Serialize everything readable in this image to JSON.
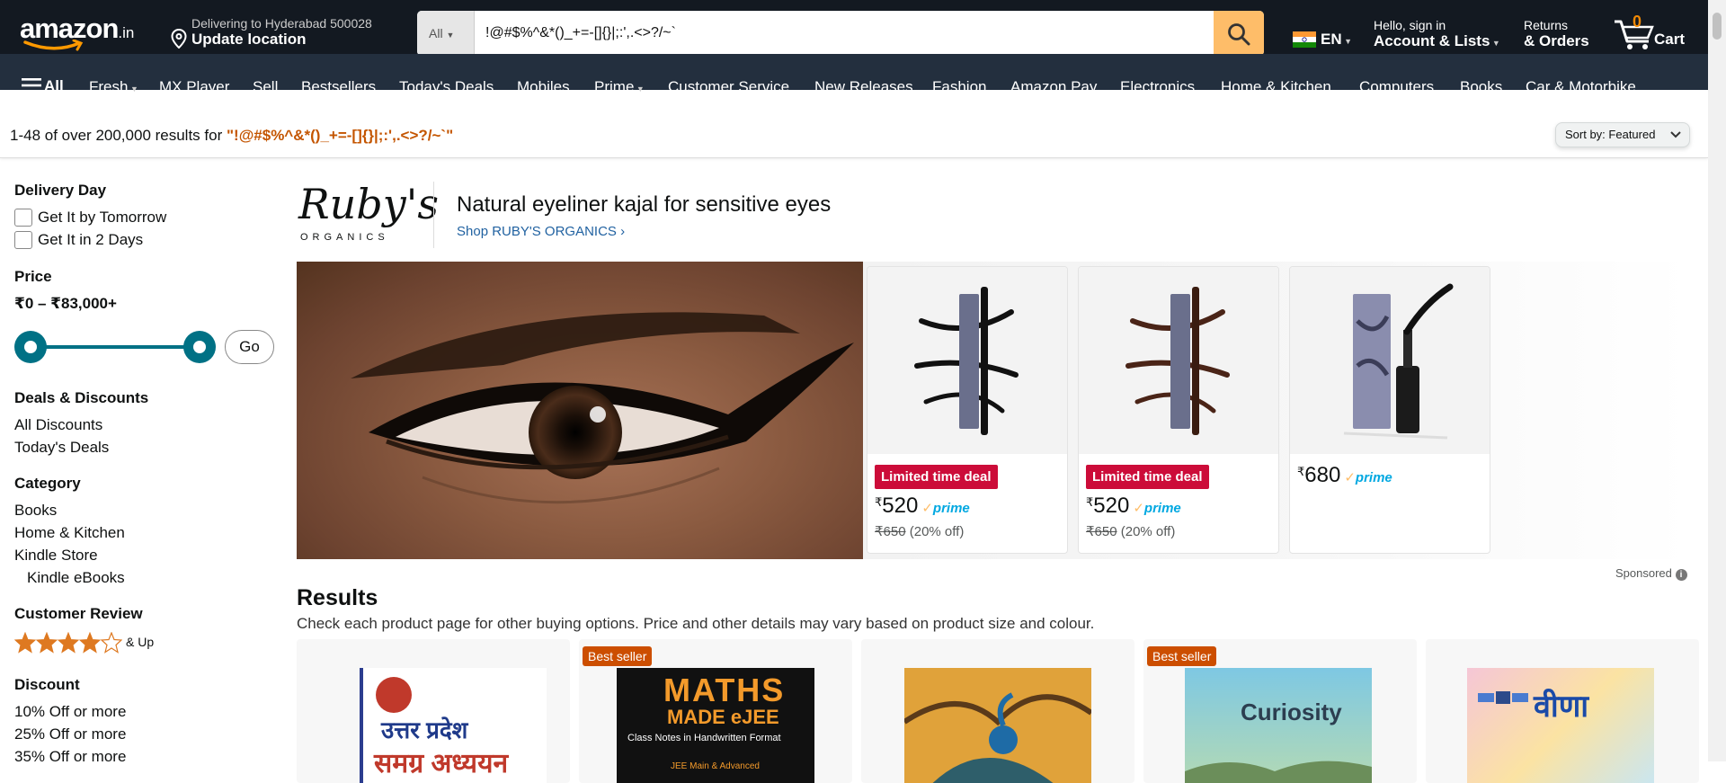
{
  "header": {
    "logo_text": "amazon",
    "logo_suffix": ".in",
    "deliver_line1": "Delivering to Hyderabad 500028",
    "deliver_line2": "Update location",
    "search_category": "All",
    "search_value": "!@#$%^&*()_+=-[]{}|;:',.<>?/~`",
    "language": "EN",
    "account_line1": "Hello, sign in",
    "account_line2": "Account & Lists",
    "returns_line1": "Returns",
    "returns_line2": "& Orders",
    "cart_count": "0",
    "cart_label": "Cart"
  },
  "nav": {
    "all_label": "All",
    "items": [
      "Fresh",
      "MX Player",
      "Sell",
      "Bestsellers",
      "Today's Deals",
      "Mobiles",
      "Prime",
      "Customer Service",
      "New Releases",
      "Fashion",
      "Amazon Pay",
      "Electronics",
      "Home & Kitchen",
      "Computers",
      "Books",
      "Car & Motorbike"
    ]
  },
  "results_bar": {
    "count_text": "1-48 of over 200,000 results for ",
    "query": "\"!@#$%^&*()_+=-[]{}|;:',.<>?/~`\"",
    "sort_label": "Sort by:",
    "sort_value": "Featured"
  },
  "sidebar": {
    "delivery_title": "Delivery Day",
    "delivery_options": [
      "Get It by Tomorrow",
      "Get It in 2 Days"
    ],
    "price_title": "Price",
    "price_range": "₹0 – ₹83,000+",
    "go_label": "Go",
    "deals_title": "Deals & Discounts",
    "deals_links": [
      "All Discounts",
      "Today's Deals"
    ],
    "category_title": "Category",
    "category_links": [
      "Books",
      "Home & Kitchen",
      "Kindle Store"
    ],
    "category_sub": "Kindle eBooks",
    "review_title": "Customer Review",
    "review_stars": 4,
    "review_suffix": "& Up",
    "discount_title": "Discount",
    "discount_links": [
      "10% Off or more",
      "25% Off or more",
      "35% Off or more"
    ]
  },
  "sponsored_brand": {
    "logo_word": "Ruby's",
    "logo_sub": "ORGANICS",
    "title": "Natural eyeliner kajal for sensitive eyes",
    "shop_link": "Shop RUBY'S ORGANICS ›",
    "products": [
      {
        "deal": "Limited time deal",
        "currency": "₹",
        "price": "520",
        "mrp": "₹650",
        "off": "(20% off)",
        "prime": "prime"
      },
      {
        "deal": "Limited time deal",
        "currency": "₹",
        "price": "520",
        "mrp": "₹650",
        "off": "(20% off)",
        "prime": "prime"
      },
      {
        "deal": "",
        "currency": "₹",
        "price": "680",
        "mrp": "",
        "off": "",
        "prime": "prime"
      }
    ],
    "sponsored_label": "Sponsored"
  },
  "results": {
    "heading": "Results",
    "subheading": "Check each product page for other buying options. Price and other details may vary based on product size and colour.",
    "badges": [
      "",
      "Best seller",
      "",
      "Best seller",
      ""
    ],
    "book_texts": [
      "उत्तर प्रदेश",
      "समग्र अध्ययन",
      "MATHS",
      "MADE eJEE",
      "Class Notes in Handwritten Format",
      "JEE Main & Advanced",
      "Curiosity",
      "वीणा"
    ]
  },
  "colors": {
    "topbar": "#131921",
    "navbar": "#232f3e",
    "accent": "#febd69",
    "link": "#007185",
    "deal": "#cc0c39",
    "bestseller": "#cc4e00",
    "query": "#c45500"
  }
}
